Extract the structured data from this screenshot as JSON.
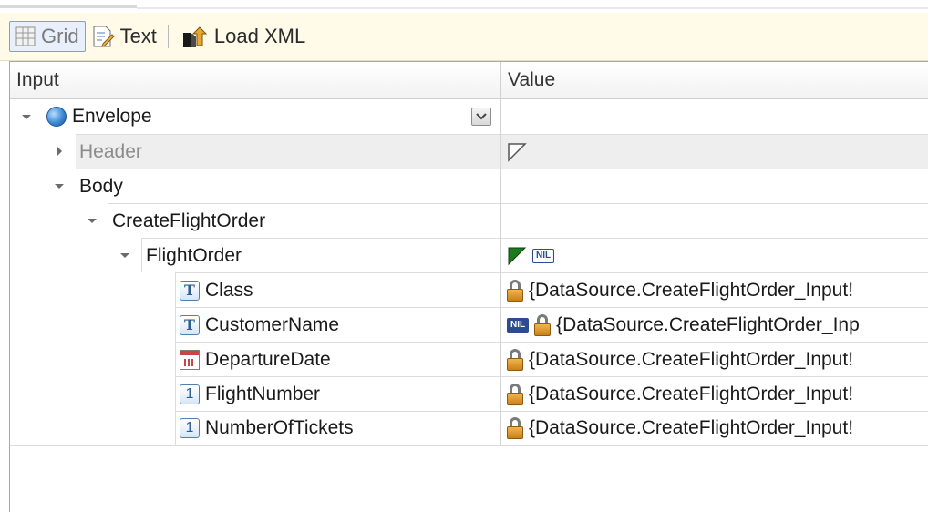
{
  "toolbar": {
    "grid_label": "Grid",
    "text_label": "Text",
    "load_xml_label": "Load XML"
  },
  "columns": {
    "input": "Input",
    "value": "Value"
  },
  "tree": {
    "envelope": "Envelope",
    "header": "Header",
    "body": "Body",
    "create_flight_order": "CreateFlightOrder",
    "flight_order": "FlightOrder",
    "nil_badge": "NIL",
    "fields": [
      {
        "name": "Class",
        "type": "T",
        "value": "{DataSource.CreateFlightOrder_Input!"
      },
      {
        "name": "CustomerName",
        "type": "T",
        "value": "{DataSource.CreateFlightOrder_Inp"
      },
      {
        "name": "DepartureDate",
        "type": "date",
        "value": "{DataSource.CreateFlightOrder_Input!"
      },
      {
        "name": "FlightNumber",
        "type": "1",
        "value": "{DataSource.CreateFlightOrder_Input!"
      },
      {
        "name": "NumberOfTickets",
        "type": "1",
        "value": "{DataSource.CreateFlightOrder_Input!"
      }
    ]
  },
  "colors": {
    "toolbar_bg": "#fffbe8",
    "icon_blue": "#2d5d93",
    "lock": "#e0a030",
    "flag_green": "#1f7a1f"
  },
  "icons": [
    "grid-icon",
    "text-edit-icon",
    "load-xml-icon",
    "globe-icon",
    "lock-icon",
    "calendar-icon",
    "text-type-icon",
    "number-type-icon",
    "flag-icon",
    "nil-badge"
  ]
}
